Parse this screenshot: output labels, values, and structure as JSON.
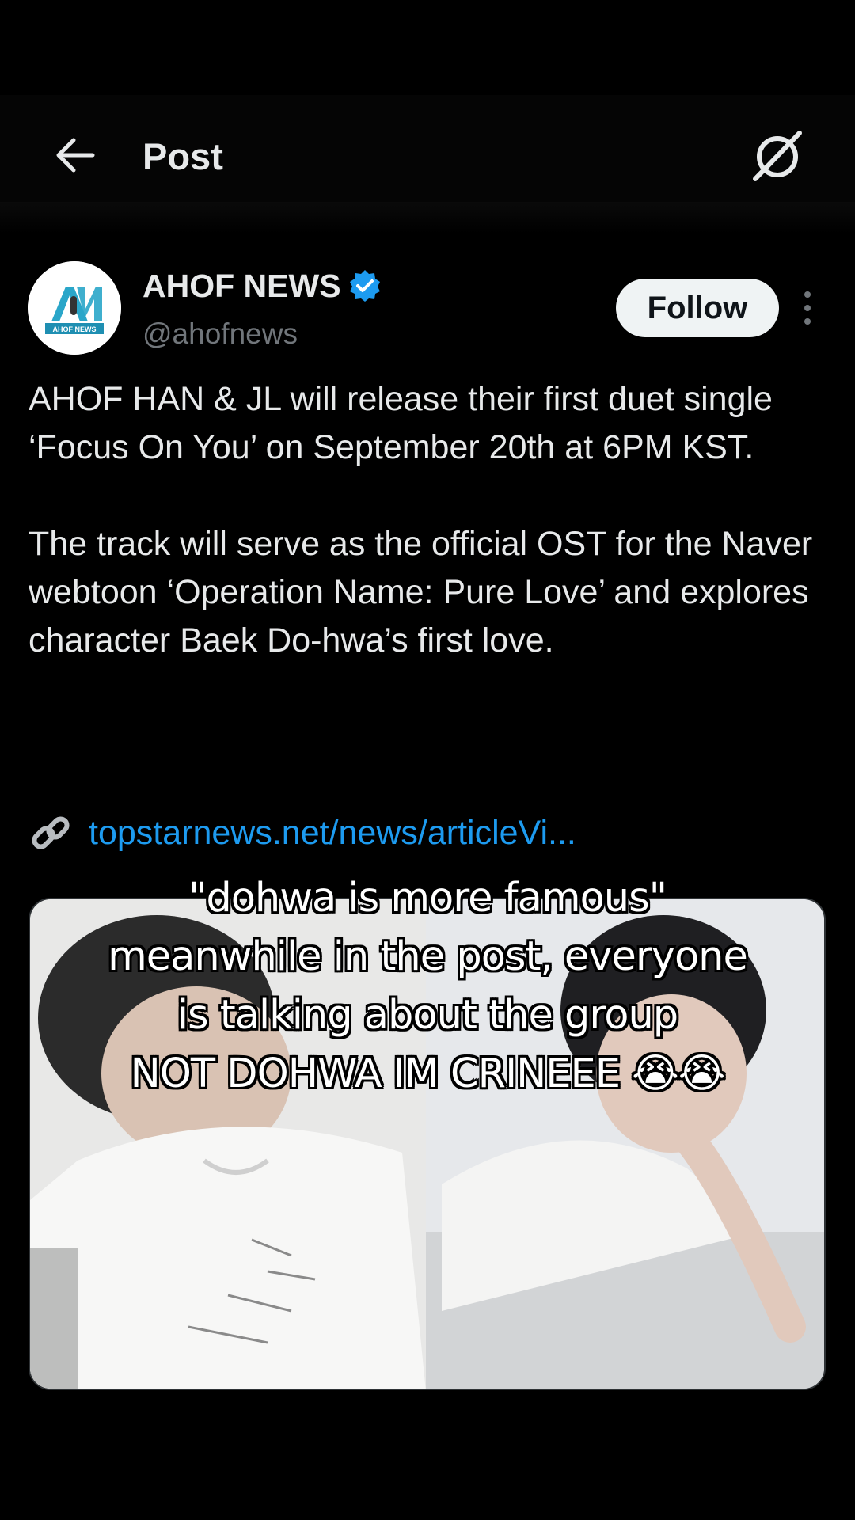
{
  "header": {
    "title": "Post"
  },
  "post": {
    "author_name": "AHOF NEWS",
    "handle": "@ahofnews",
    "avatar_text": "AHOF NEWS",
    "follow_label": "Follow",
    "body": [
      "AHOF HAN & JL will release their first duet single ‘Focus On You’ on September 20th at 6PM KST.",
      "The track will serve as the official OST for the Naver webtoon ‘Operation Name: Pure Love’ and explores character Baek Do-hwa’s first love."
    ],
    "link_icon": "link-icon",
    "link_text": "topstarnews.net/news/articleVi..."
  },
  "overlay_caption": [
    "\"dohwa is more famous\"",
    "meanwhile in the post, everyone",
    "is talking about the group",
    "NOT DOHWA IM CRINEEE 😭😭"
  ],
  "colors": {
    "background": "#000000",
    "text": "#e7e9ea",
    "secondary_text": "#71767b",
    "link": "#1d9bf0",
    "verified": "#1d9bf0",
    "follow_bg": "#eff3f4"
  }
}
